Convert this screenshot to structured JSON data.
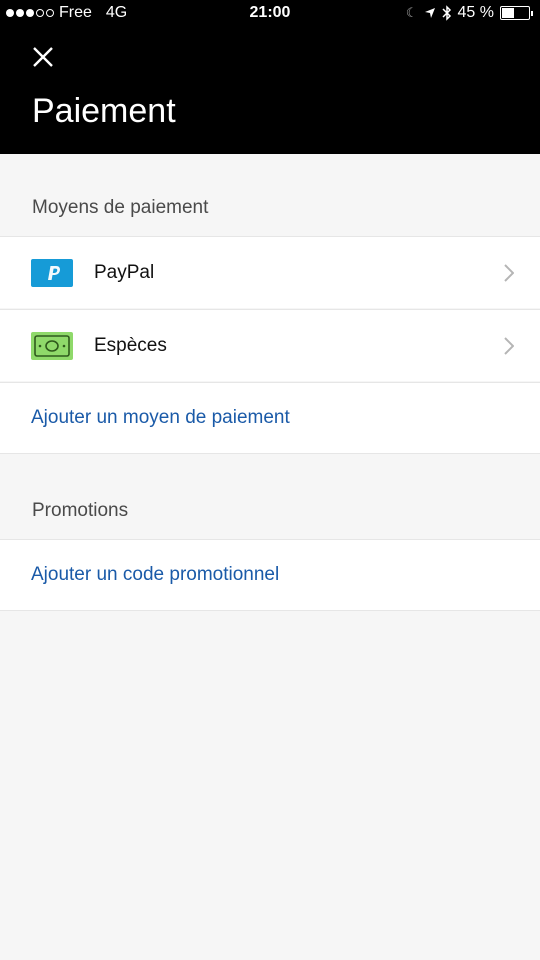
{
  "status_bar": {
    "carrier": "Free",
    "network": "4G",
    "time": "21:00",
    "battery": "45 %",
    "battery_level": 0.45
  },
  "header": {
    "title": "Paiement",
    "close_icon": "close-icon"
  },
  "payment_methods": {
    "section_title": "Moyens de paiement",
    "items": [
      {
        "label": "PayPal",
        "icon": "paypal-icon"
      },
      {
        "label": "Espèces",
        "icon": "cash-icon"
      }
    ],
    "add_link": "Ajouter un moyen de paiement"
  },
  "promotions": {
    "section_title": "Promotions",
    "add_link": "Ajouter un code promotionnel"
  },
  "colors": {
    "header_bg": "#000000",
    "link": "#1a5aa8",
    "paypal_blue": "#169bd7",
    "cash_green": "#8fd96a",
    "page_bg": "#f6f6f6"
  }
}
